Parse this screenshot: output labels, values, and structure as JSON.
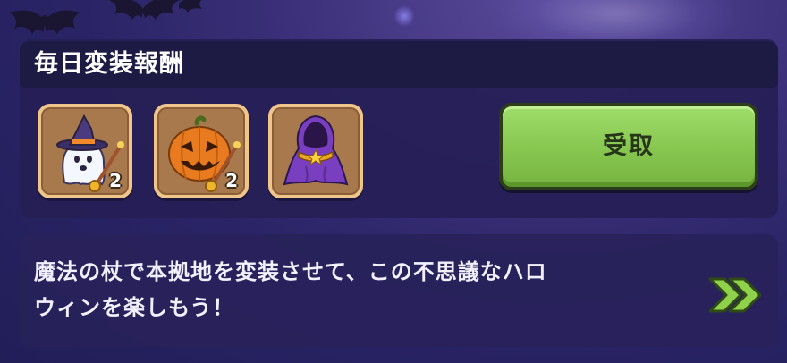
{
  "panel": {
    "title": "毎日変装報酬"
  },
  "rewards": [
    {
      "icon": "ghost-witch-wand-icon",
      "count": "2"
    },
    {
      "icon": "jack-o-lantern-wand-icon",
      "count": "2"
    },
    {
      "icon": "purple-cloak-icon",
      "count": ""
    }
  ],
  "claim_button": {
    "label": "受取"
  },
  "description": {
    "line1": "魔法の杖で本拠地を変装させて、この不思議なハロ",
    "line2": "ウィンを楽しもう！"
  },
  "colors": {
    "background": "#2a2466",
    "slot_fill": "#a7794d",
    "slot_border": "#f0c58c",
    "button_green": "#86c64f",
    "arrow_green": "#8fd14a"
  }
}
